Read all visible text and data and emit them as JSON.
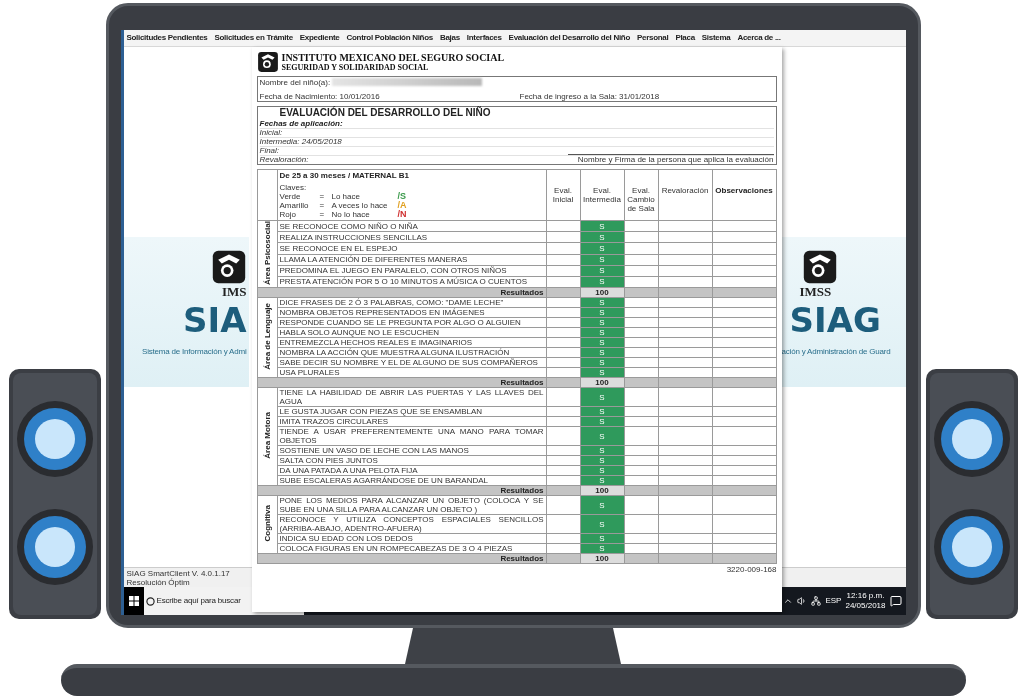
{
  "menu": [
    "Solicitudes Pendientes",
    "Solicitudes en Trámite",
    "Expediente",
    "Control Población Niños",
    "Bajas",
    "Interfaces",
    "Evaluación del Desarrollo del Niño",
    "Personal",
    "Placa",
    "Sistema",
    "Acerca de ..."
  ],
  "splash_left": {
    "logo_text": "IMS",
    "title": "SIA",
    "subtitle": "Sistema de Información y Admi"
  },
  "splash_right": {
    "logo_text": "IMSS",
    "title": "SIAG",
    "subtitle": "ación y Administración de Guard"
  },
  "status_bar": [
    "SIAG SmartClient V. 4.0.1.17",
    "Resolución Óptim"
  ],
  "taskbar": {
    "search_placeholder": "Escribe aquí para buscar",
    "language": "ESP",
    "time": "12:16 p.m.",
    "date": "24/05/2018"
  },
  "document": {
    "org_name": "INSTITUTO MEXICANO DEL SEGURO SOCIAL",
    "org_tagline": "SEGURIDAD Y SOLIDARIDAD SOCIAL",
    "child_label": "Nombre del niño(a):",
    "birth": "Fecha de Nacimiento: 10/01/2016",
    "entry": "Fecha de ingreso a la Sala: 31/01/2018",
    "title": "EVALUACIÓN DEL DESARROLLO DEL NIÑO",
    "dates_heading": "Fechas de aplicación:",
    "dates": [
      "Inicial:",
      "Intermedia: 24/05/2018",
      "Final:",
      "Revaloración:"
    ],
    "signature": "Nombre y Firma de la persona que aplica la evaluación",
    "group": "De 25 a 30 meses / MATERNAL B1",
    "keys_heading": "Claves:",
    "keys": [
      {
        "name": "Verde",
        "eq": "=",
        "meaning": "Lo hace",
        "code": "/S",
        "color": "#3a9a4a"
      },
      {
        "name": "Amarillo",
        "eq": "=",
        "meaning": "A veces lo hace",
        "code": "/A",
        "color": "#e0a020"
      },
      {
        "name": "Rojo",
        "eq": "=",
        "meaning": "No lo hace",
        "code": "/N",
        "color": "#d03030"
      }
    ],
    "columns": [
      "Eval. Inicial",
      "Eval. Intermedia",
      "Eval. Cambio de Sala",
      "Revaloración",
      "Observaciones"
    ],
    "areas": [
      {
        "name": "Área Psicosocial",
        "results_label": "Resultados",
        "score": "100",
        "items": [
          {
            "text": "SE RECONOCE COMO NIÑO O NIÑA",
            "intermedia": "S"
          },
          {
            "text": "REALIZA INSTRUCCIONES SENCILLAS",
            "intermedia": "S"
          },
          {
            "text": "SE RECONOCE EN EL ESPEJO",
            "intermedia": "S"
          },
          {
            "text": "LLAMA LA ATENCIÓN DE DIFERENTES MANERAS",
            "intermedia": "S"
          },
          {
            "text": "PREDOMINA EL JUEGO EN PARALELO, CON OTROS NIÑOS",
            "intermedia": "S"
          },
          {
            "text": "PRESTA ATENCIÓN POR 5 O 10 MINUTOS A MÚSICA O CUENTOS",
            "intermedia": "S"
          }
        ]
      },
      {
        "name": "Área de Lenguaje",
        "results_label": "Resultados",
        "score": "100",
        "items": [
          {
            "text": "DICE FRASES DE 2 Ó 3 PALABRAS, COMO: \"DAME LECHE\"",
            "intermedia": "S"
          },
          {
            "text": "NOMBRA OBJETOS REPRESENTADOS EN IMÁGENES",
            "intermedia": "S"
          },
          {
            "text": "RESPONDE CUANDO SE LE PREGUNTA POR ALGO O ALGUIEN",
            "intermedia": "S"
          },
          {
            "text": "HABLA SOLO AUNQUE NO LE ESCUCHEN",
            "intermedia": "S"
          },
          {
            "text": "ENTREMEZCLA HECHOS REALES E IMAGINARIOS",
            "intermedia": "S"
          },
          {
            "text": "NOMBRA LA ACCIÓN QUE MUESTRA ALGUNA ILUSTRACIÓN",
            "intermedia": "S"
          },
          {
            "text": "SABE DECIR SU NOMBRE Y EL DE ALGUNO DE SUS COMPAÑEROS",
            "intermedia": "S"
          },
          {
            "text": "USA PLURALES",
            "intermedia": "S"
          }
        ]
      },
      {
        "name": "Área Motora",
        "results_label": "Resultados",
        "score": "100",
        "items": [
          {
            "text": "TIENE LA HABILIDAD DE ABRIR LAS PUERTAS Y LAS LLAVES DEL AGUA",
            "intermedia": "S"
          },
          {
            "text": "LE GUSTA JUGAR CON PIEZAS QUE SE ENSAMBLAN",
            "intermedia": "S"
          },
          {
            "text": "IMITA TRAZOS CIRCULARES",
            "intermedia": "S"
          },
          {
            "text": "TIENDE A USAR PREFERENTEMENTE UNA MANO PARA TOMAR OBJETOS",
            "intermedia": "S"
          },
          {
            "text": "SOSTIENE UN VASO DE LECHE CON LAS MANOS",
            "intermedia": "S"
          },
          {
            "text": "SALTA CON PIES JUNTOS",
            "intermedia": "S"
          },
          {
            "text": "DA UNA PATADA A UNA PELOTA FIJA",
            "intermedia": "S"
          },
          {
            "text": "SUBE ESCALERAS AGARRÁNDOSE DE UN BARANDAL",
            "intermedia": "S"
          }
        ]
      },
      {
        "name": "Cognitiva",
        "results_label": "Resultados",
        "score": "100",
        "items": [
          {
            "text": "PONE LOS MEDIOS PARA ALCANZAR UN OBJETO (COLOCA Y SE SUBE EN UNA SILLA PARA ALCANZAR UN OBJETO )",
            "intermedia": "S"
          },
          {
            "text": "RECONOCE Y UTILIZA CONCEPTOS ESPACIALES SENCILLOS (ARRIBA-ABAJO, ADENTRO-AFUERA)",
            "intermedia": "S"
          },
          {
            "text": "INDICA SU EDAD CON LOS DEDOS",
            "intermedia": "S"
          },
          {
            "text": "COLOCA FIGURAS EN UN ROMPECABEZAS DE 3 O 4 PIEZAS",
            "intermedia": "S"
          }
        ]
      }
    ],
    "footer_code": "3220-009-168"
  }
}
